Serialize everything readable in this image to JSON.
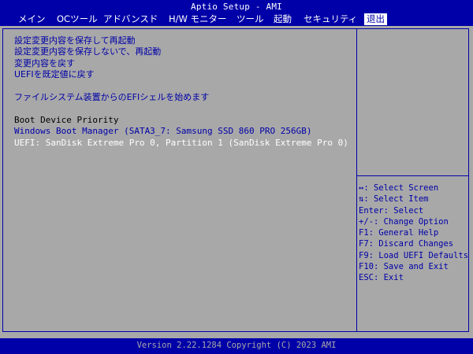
{
  "app": {
    "title": "Aptio Setup - AMI"
  },
  "menu": {
    "items": [
      {
        "label": "メイン",
        "active": false
      },
      {
        "label": "OCツール",
        "active": false
      },
      {
        "label": "アドバンスド",
        "active": false
      },
      {
        "label": "H/W モニター",
        "active": false
      },
      {
        "label": "ツール",
        "active": false
      },
      {
        "label": "起動",
        "active": false
      },
      {
        "label": "セキュリティ",
        "active": false
      },
      {
        "label": "退出",
        "active": true
      }
    ]
  },
  "options": {
    "save_changes_reboot": "設定変更内容を保存して再起動",
    "discard_changes_reboot": "設定変更内容を保存しないで、再起動",
    "discard_changes": "変更内容を戻す",
    "load_defaults": "UEFIを既定値に戻す",
    "launch_efi_shell": "ファイルシステム装置からのEFIシェルを始めます",
    "boot_priority_heading": "Boot Device Priority",
    "boot_devices": [
      {
        "label": "Windows Boot Manager (SATA3_7: Samsung SSD 860 PRO 256GB)",
        "selected": false
      },
      {
        "label": "UEFI: SanDisk Extreme Pro 0, Partition 1 (SanDisk Extreme Pro 0)",
        "selected": true
      }
    ]
  },
  "help": {
    "lines": [
      "↔: Select Screen",
      "⇅: Select Item",
      "Enter: Select",
      "+/-: Change Option",
      "F1: General Help",
      "F7: Discard Changes",
      "F9: Load UEFI Defaults",
      "F10: Save and Exit",
      "ESC: Exit"
    ]
  },
  "footer": {
    "text": "Version 2.22.1284 Copyright (C) 2023 AMI"
  },
  "colors": {
    "background": "#a8a8a8",
    "bios_blue": "#0000a8",
    "highlight": "#ffffff",
    "heading": "#000000"
  }
}
